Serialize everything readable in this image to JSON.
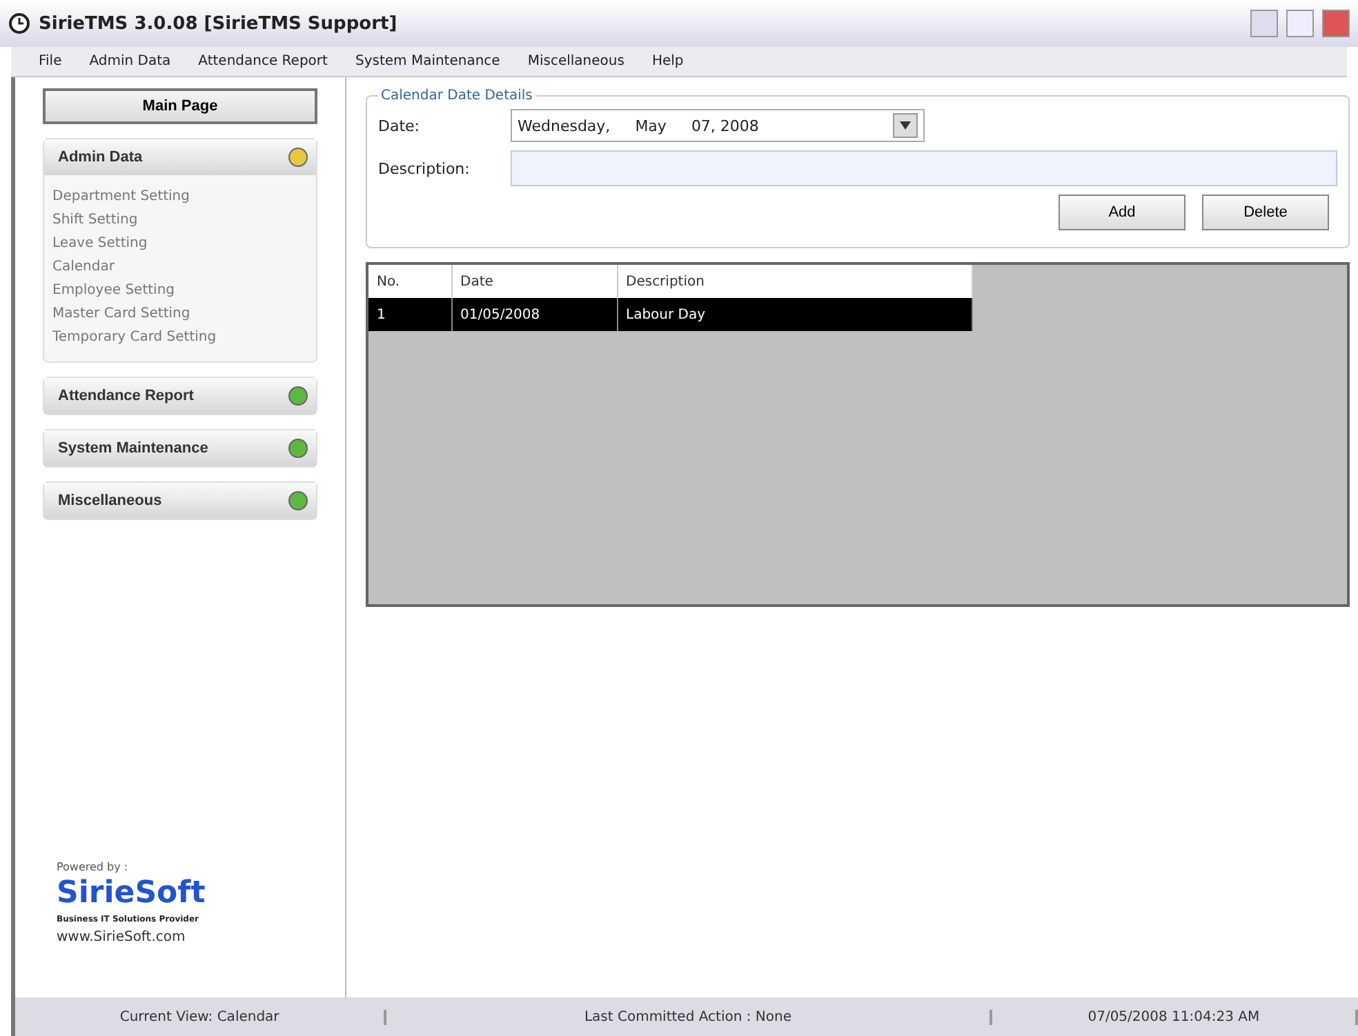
{
  "window": {
    "title": "SirieTMS 3.0.08 [SirieTMS Support]"
  },
  "menu": [
    "File",
    "Admin Data",
    "Attendance Report",
    "System Maintenance",
    "Miscellaneous",
    "Help"
  ],
  "sidebar": {
    "main_button": "Main Page",
    "sections": [
      {
        "title": "Admin Data",
        "expanded": true,
        "items": [
          "Department Setting",
          "Shift Setting",
          "Leave Setting",
          "Calendar",
          "Employee Setting",
          "Master Card Setting",
          "Temporary Card Setting"
        ]
      },
      {
        "title": "Attendance Report",
        "expanded": false
      },
      {
        "title": "System Maintenance",
        "expanded": false
      },
      {
        "title": "Miscellaneous",
        "expanded": false
      }
    ],
    "powered_by": "Powered by :",
    "logo": "SirieSoft",
    "tagline": "Business IT Solutions Provider",
    "website": "www.SirieSoft.com"
  },
  "form": {
    "legend": "Calendar Date Details",
    "date_label": "Date:",
    "date_day": "Wednesday,",
    "date_month": "May",
    "date_rest": "07, 2008",
    "description_label": "Description:",
    "buttons": [
      "Add",
      "Delete"
    ]
  },
  "table": {
    "columns": [
      "No.",
      "Date",
      "Description"
    ],
    "rows": [
      {
        "cells": [
          "1",
          "01/05/2008",
          "Labour Day"
        ],
        "selected": true
      }
    ]
  },
  "status_bar": [
    "Current View: Calendar",
    "Last Committed Action : None",
    "07/05/2008 11:04:23 AM"
  ]
}
